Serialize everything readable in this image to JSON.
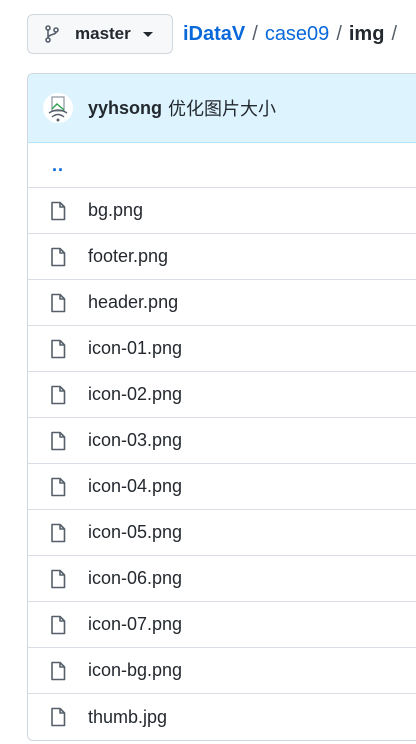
{
  "branch": {
    "label": "master",
    "icon": "git-branch-icon"
  },
  "breadcrumb": {
    "root": "iDataV",
    "parent": "case09",
    "current": "img",
    "separator": "/"
  },
  "commit": {
    "author": "yyhsong",
    "message": "优化图片大小",
    "avatar_icon": "avatar-icon"
  },
  "parent_dir": "..",
  "files": [
    {
      "name": "bg.png",
      "icon": "file-icon"
    },
    {
      "name": "footer.png",
      "icon": "file-icon"
    },
    {
      "name": "header.png",
      "icon": "file-icon"
    },
    {
      "name": "icon-01.png",
      "icon": "file-icon"
    },
    {
      "name": "icon-02.png",
      "icon": "file-icon"
    },
    {
      "name": "icon-03.png",
      "icon": "file-icon"
    },
    {
      "name": "icon-04.png",
      "icon": "file-icon"
    },
    {
      "name": "icon-05.png",
      "icon": "file-icon"
    },
    {
      "name": "icon-06.png",
      "icon": "file-icon"
    },
    {
      "name": "icon-07.png",
      "icon": "file-icon"
    },
    {
      "name": "icon-bg.png",
      "icon": "file-icon"
    },
    {
      "name": "thumb.jpg",
      "icon": "file-icon"
    }
  ],
  "colors": {
    "link": "#0969da",
    "commit_bar_bg": "#ddf4ff",
    "border": "#d0d7de",
    "text": "#24292f"
  }
}
